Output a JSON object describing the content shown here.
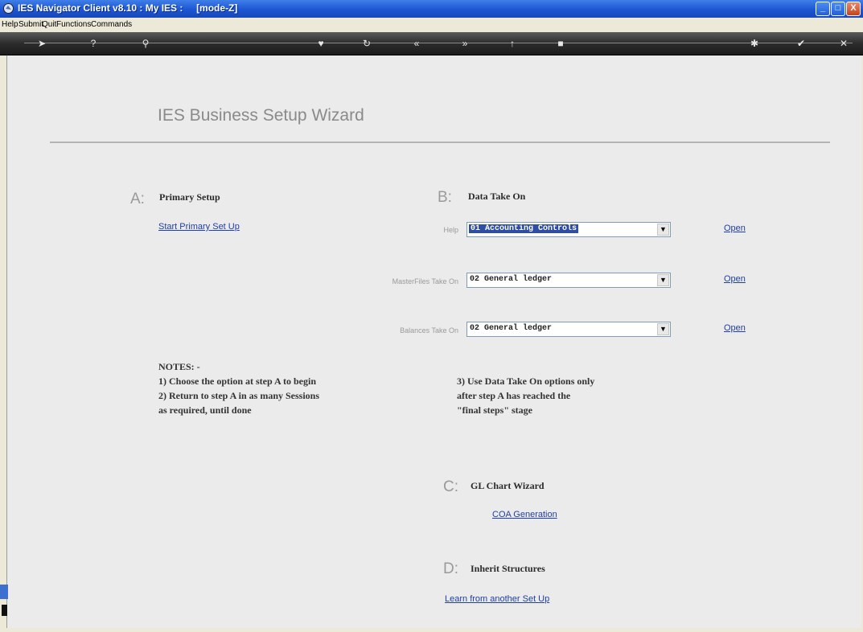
{
  "window": {
    "title": "IES Navigator Client v8.10 : My IES :     [mode-Z]",
    "min_glyph": "_",
    "max_glyph": "□",
    "close_glyph": "X"
  },
  "menu": [
    "Help",
    "Submit",
    "Quit",
    "Functions",
    "Commands"
  ],
  "toolbar_icons": [
    {
      "name": "arrow-icon",
      "glyph": "➤"
    },
    {
      "name": "help-icon",
      "glyph": "?"
    },
    {
      "name": "search-icon",
      "glyph": "⚲"
    },
    {
      "name": "heart-icon",
      "glyph": "♥"
    },
    {
      "name": "refresh-icon",
      "glyph": "↻"
    },
    {
      "name": "back-icon",
      "glyph": "«"
    },
    {
      "name": "forward-icon",
      "glyph": "»"
    },
    {
      "name": "up-icon",
      "glyph": "↑"
    },
    {
      "name": "stop-icon",
      "glyph": "■"
    },
    {
      "name": "star-icon",
      "glyph": "✱"
    },
    {
      "name": "check-icon",
      "glyph": "✔"
    },
    {
      "name": "close-icon",
      "glyph": "✕"
    }
  ],
  "wizard": {
    "title": "IES Business Setup Wizard",
    "section_a": {
      "letter": "A:",
      "title": "Primary Setup",
      "link": "Start Primary Set Up"
    },
    "section_b": {
      "letter": "B:",
      "title": "Data Take On",
      "rows": [
        {
          "label": "Help",
          "value": "01 Accounting Controls",
          "open": "Open"
        },
        {
          "label": "MasterFiles Take On",
          "value": "02 General ledger",
          "open": "Open"
        },
        {
          "label": "Balances Take On",
          "value": "02 General ledger",
          "open": "Open"
        }
      ]
    },
    "notes": {
      "heading": "NOTES: -",
      "left": [
        "1) Choose the option at step A to begin",
        "2) Return to step A in as many Sessions",
        "as required, until done"
      ],
      "right": [
        "3) Use Data Take On options only",
        "after step A has reached the",
        "\"final steps\" stage"
      ]
    },
    "section_c": {
      "letter": "C:",
      "title": "GL Chart Wizard",
      "link": "COA Generation"
    },
    "section_d": {
      "letter": "D:",
      "title": "Inherit Structures",
      "link": "Learn from another Set Up"
    }
  },
  "colors": {
    "titlebar": "#1c55d3",
    "link": "#1f3ea8",
    "background": "#ebebeb",
    "select_highlight": "#2f4ea3"
  }
}
